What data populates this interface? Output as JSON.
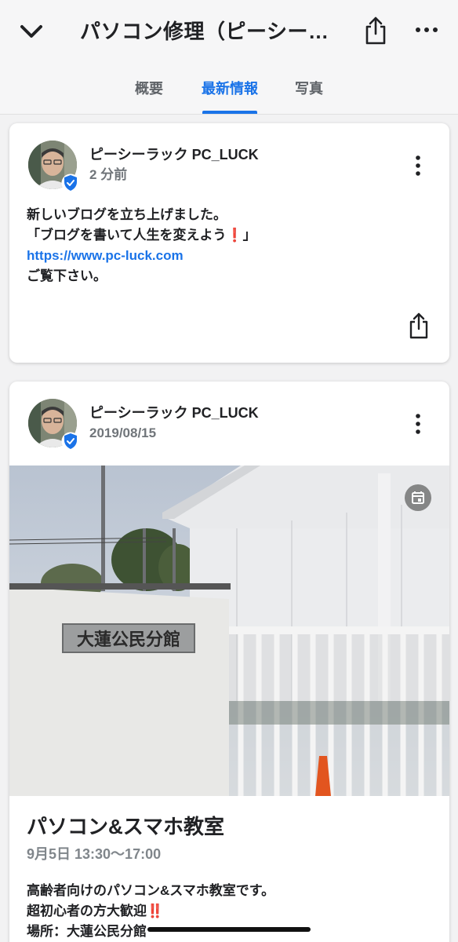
{
  "header": {
    "title": "パソコン修理（ピーシー…"
  },
  "tabs": [
    {
      "label": "概要"
    },
    {
      "label": "最新情報"
    },
    {
      "label": "写真"
    }
  ],
  "active_tab": "最新情報",
  "posts": [
    {
      "author": "ピーシーラック PC_LUCK",
      "time": "2 分前",
      "lines": {
        "l1": "新しいブログを立ち上げました。",
        "l2_a": "「ブログを書いて人生を変えよう",
        "l2_mark": "❗",
        "l2_b": "」",
        "link": "https://www.pc-luck.com",
        "l4": "ご覧下さい。"
      }
    },
    {
      "author": "ピーシーラック PC_LUCK",
      "time": "2019/08/15",
      "photo": {
        "sign_text": "大蓮公民分館"
      },
      "event": {
        "title": "パソコン&スマホ教室",
        "date": "9月5日 13:30〜17:00",
        "desc_l1": "高齢者向けのパソコン&スマホ教室です。",
        "desc_l2": "超初心者の方大歓迎",
        "desc_l2_mark": "‼️",
        "desc_l3": "場所：大蓮公民分館"
      }
    }
  ],
  "colors": {
    "accent": "#1a73e8",
    "verified": "#1a73e8",
    "background": "#f2f2f3",
    "card": "#ffffff"
  },
  "icons": {
    "back": "chevron-down-icon",
    "share": "share-icon",
    "more": "more-horizontal-icon",
    "card_more": "more-vertical-icon",
    "verified": "verified-badge-icon",
    "event": "calendar-icon"
  }
}
